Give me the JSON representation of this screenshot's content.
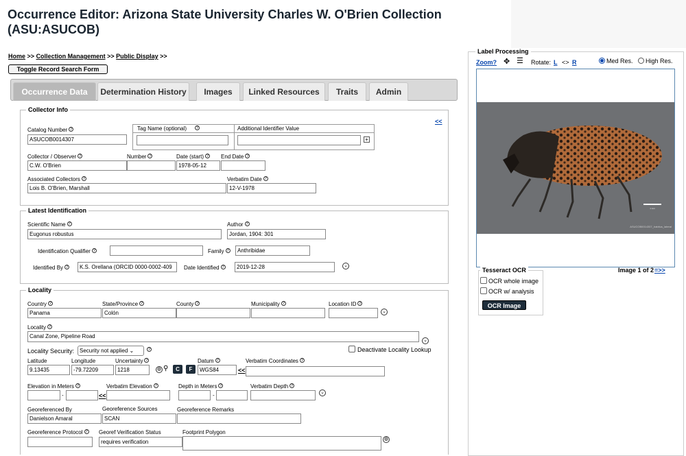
{
  "page": {
    "title": "Occurrence Editor: Arizona State University Charles W. O'Brien Collection (ASU:ASUCOB)"
  },
  "breadcrumb": {
    "home": "Home",
    "sep": ">>",
    "collection_mgmt": "Collection Management",
    "public_display": "Public Display"
  },
  "toggle_button": "Toggle Record Search Form",
  "tabs": [
    "Occurrence Data",
    "Determination History",
    "Images",
    "Linked Resources",
    "Traits",
    "Admin"
  ],
  "collector": {
    "legend": "Collector Info",
    "collapse_link": "<<",
    "catalog_label": "Catalog Number",
    "catalog_value": "ASUCOB0014307",
    "tag_label": "Tag Name (optional)",
    "tag_value": "",
    "addl_label": "Additional Identifier Value",
    "addl_value": "",
    "collector_label": "Collector / Observer",
    "collector_value": "C.W. O'Brien",
    "number_label": "Number",
    "number_value": "",
    "date_label": "Date (start)",
    "date_value": "1978-05-12",
    "end_label": "End Date",
    "end_value": "",
    "assoc_label": "Associated Collectors",
    "assoc_value": "Lois B. O'Brien, Marshall",
    "verbatim_label": "Verbatim Date",
    "verbatim_value": "12-V-1978"
  },
  "identification": {
    "legend": "Latest Identification",
    "sci_label": "Scientific Name",
    "sci_value": "Eugonus robustus",
    "author_label": "Author",
    "author_value": "Jordan, 1904: 301",
    "qual_label": "Identification Qualifier",
    "qual_value": "",
    "family_label": "Family",
    "family_value": "Anthribidae",
    "by_label": "Identified By",
    "by_value": "K.S. Orellana (ORCID 0000-0002-409",
    "date_label": "Date Identified",
    "date_value": "2019-12-28"
  },
  "locality": {
    "legend": "Locality",
    "country_label": "Country",
    "country_value": "Panama",
    "state_label": "State/Province",
    "state_value": "Colón",
    "county_label": "County",
    "county_value": "",
    "muni_label": "Municipality",
    "muni_value": "",
    "locid_label": "Location ID",
    "locid_value": "",
    "locality_label": "Locality",
    "locality_value": "Canal Zone, Pipeline Road",
    "security_label": "Locality Security:",
    "security_value": "Security not applied",
    "deactivate_label": "Deactivate Locality Lookup",
    "lat_label": "Latitude",
    "lat_value": "9.13435",
    "lon_label": "Longitude",
    "lon_value": "-79.72209",
    "unc_label": "Uncertainty",
    "unc_value": "1218",
    "c_btn": "C",
    "f_btn": "F",
    "datum_label": "Datum",
    "datum_value": "WGS84",
    "datum_link": "<<",
    "vcoord_label": "Verbatim Coordinates",
    "vcoord_value": "",
    "elev_label": "Elevation in Meters",
    "elev_min": "",
    "elev_max": "",
    "dash": "-",
    "elev_link": "<<",
    "velev_label": "Verbatim Elevation",
    "velev_value": "",
    "depth_label": "Depth in Meters",
    "depth_min": "",
    "depth_max": "",
    "vdepth_label": "Verbatim Depth",
    "vdepth_value": "",
    "georefby_label": "Georeferenced By",
    "georefby_value": "Danielson Amaral",
    "georefsrc_label": "Georeference Sources",
    "georefsrc_value": "SCAN",
    "georefrem_label": "Georeference Remarks",
    "georefrem_value": "",
    "protocol_label": "Georeference Protocol",
    "protocol_value": "",
    "verif_label": "Georef Verification Status",
    "verif_value": "requires verification",
    "footprint_label": "Footprint Polygon",
    "footprint_value": ""
  },
  "label_panel": {
    "legend": "Label Processing",
    "zoom": "Zoom?",
    "rotate_label": "Rotate:",
    "rotate_l": "L",
    "rotate_sep": "<>",
    "rotate_r": "R",
    "med_res": "Med Res.",
    "high_res": "High Res.",
    "image_caption": "ASUCOB0014307_habitus_lateral",
    "tesseract_legend": "Tesseract OCR",
    "ocr_whole": "OCR whole image",
    "ocr_analysis": "OCR w/ analysis",
    "ocr_button": "OCR Image",
    "image_count": "Image 1 of 2",
    "next_link": "=>>"
  },
  "colors": {
    "accent_link": "#0645ad",
    "dark_button": "#1e2d3a",
    "active_tab": "#b8b8b8"
  }
}
